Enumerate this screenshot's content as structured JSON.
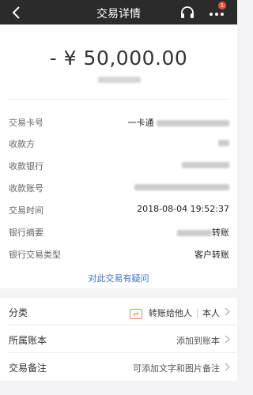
{
  "header": {
    "title": "交易详情",
    "badge_count": "1"
  },
  "summary": {
    "amount": "- ¥ 50,000.00"
  },
  "details": [
    {
      "label": "交易卡号",
      "value": "一卡通"
    },
    {
      "label": "收款方",
      "value": ""
    },
    {
      "label": "收款银行",
      "value": ""
    },
    {
      "label": "收款账号",
      "value": ""
    },
    {
      "label": "交易时间",
      "value": "2018-08-04 19:52:37"
    },
    {
      "label": "银行摘要",
      "value": "转账"
    },
    {
      "label": "银行交易类型",
      "value": "客户转账"
    }
  ],
  "dispute_link": "对此交易有疑问",
  "extras": {
    "category": {
      "label": "分类",
      "value": "转账给他人",
      "owner": "本人"
    },
    "account": {
      "label": "所属账本",
      "value": "添加到账本"
    },
    "note": {
      "label": "交易备注",
      "value": "可添加文字和图片备注"
    }
  },
  "colors": {
    "nav_bg": "#2b2b2b",
    "link": "#3b73c8",
    "badge": "#f2503f",
    "category_icon": "#f08a43"
  }
}
